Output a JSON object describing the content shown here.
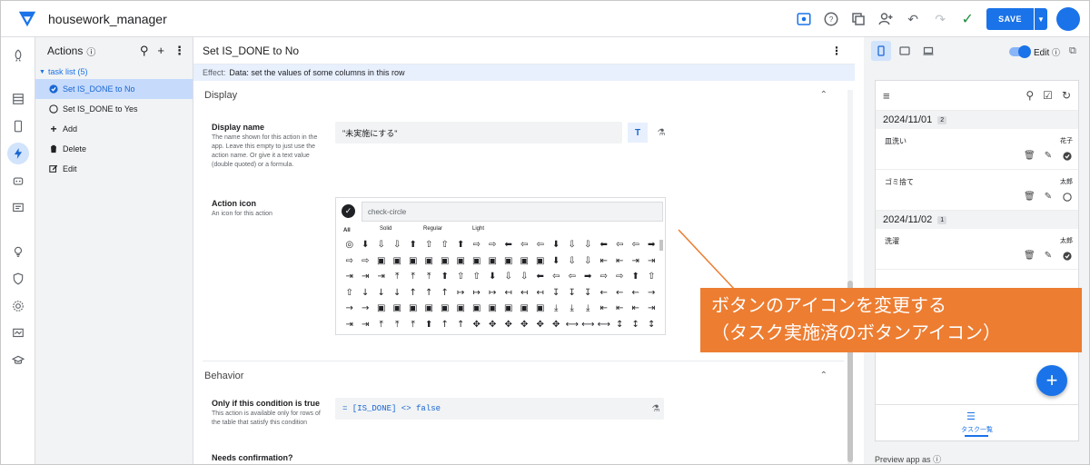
{
  "app": {
    "title": "housework_manager"
  },
  "topbar": {
    "save_label": "SAVE"
  },
  "actions_panel": {
    "title": "Actions",
    "group_label": "task list (5)",
    "items": [
      {
        "label": "Set IS_DONE to No"
      },
      {
        "label": "Set IS_DONE to Yes"
      },
      {
        "label": "Add"
      },
      {
        "label": "Delete"
      },
      {
        "label": "Edit"
      }
    ]
  },
  "editor": {
    "title": "Set IS_DONE to No",
    "effect_label": "Effect:",
    "effect_value": "Data: set the values of some columns in this row",
    "display_section": "Display",
    "display_name_label": "Display name",
    "display_name_desc": "The name shown for this action in the app. Leave this empty to just use the action name. Or give it a text value (double quoted) or a formula.",
    "display_name_value": "\"未実施にする\"",
    "action_icon_label": "Action icon",
    "action_icon_desc": "An icon for this action",
    "icon_search_placeholder": "check-circle",
    "picker_tabs": [
      "All",
      "Solid",
      "Regular",
      "Light"
    ],
    "behavior_section": "Behavior",
    "condition_label": "Only if this condition is true",
    "condition_desc": "This action is available only for rows of the table that satisfy this condition",
    "condition_value": "= [IS_DONE] <> false",
    "confirm_label": "Needs confirmation?"
  },
  "glyph_rows": [
    [
      "◎",
      "⬇",
      "⇩",
      "⇩",
      "⬆",
      "⇧",
      "⇧",
      "⬆",
      "⇨",
      "⇨",
      "⬅",
      "⇦",
      "⇦",
      "⬇",
      "⇩",
      "⇩",
      "⬅",
      "⇦",
      "⇦",
      "➡"
    ],
    [
      "⇨",
      "⇨",
      "▣",
      "▣",
      "▣",
      "▣",
      "▣",
      "▣",
      "▣",
      "▣",
      "▣",
      "▣",
      "▣",
      "⬇",
      "⇩",
      "⇩",
      "⇤",
      "⇤",
      "⇥",
      "⇥"
    ],
    [
      "⇥",
      "⇥",
      "⇥",
      "⤒",
      "⤒",
      "⤒",
      "⬆",
      "⇧",
      "⇧",
      "⬇",
      "⇩",
      "⇩",
      "⬅",
      "⇦",
      "⇦",
      "➡",
      "⇨",
      "⇨",
      "⬆",
      "⇧"
    ],
    [
      "⇧",
      "↓",
      "↓",
      "↓",
      "↑",
      "↑",
      "↑",
      "↦",
      "↦",
      "↦",
      "↤",
      "↤",
      "↤",
      "↧",
      "↧",
      "↧",
      "←",
      "←",
      "←",
      "→"
    ],
    [
      "→",
      "→",
      "▣",
      "▣",
      "▣",
      "▣",
      "▣",
      "▣",
      "▣",
      "▣",
      "▣",
      "▣",
      "▣",
      "⤓",
      "⤓",
      "⤓",
      "⇤",
      "⇤",
      "⇤",
      "⇥"
    ],
    [
      "⇥",
      "⇥",
      "⤒",
      "⤒",
      "⤒",
      "⬆",
      "↑",
      "↑",
      "✥",
      "✥",
      "✥",
      "✥",
      "✥",
      "✥",
      "⟷",
      "⟷",
      "⟷",
      "↕",
      "↕",
      "↕"
    ]
  ],
  "preview": {
    "edit_label": "Edit",
    "footer_label": "Preview app as",
    "groups": [
      {
        "date": "2024/11/01",
        "count": "2",
        "tasks": [
          {
            "name": "皿洗い",
            "person": "花子",
            "done": true
          },
          {
            "name": "ゴミ捨て",
            "person": "太郎",
            "done": false
          }
        ]
      },
      {
        "date": "2024/11/02",
        "count": "1",
        "tasks": [
          {
            "name": "洗濯",
            "person": "太郎",
            "done": true
          }
        ]
      }
    ],
    "nav_label": "タスク一覧"
  },
  "callout": {
    "line1": "ボタンのアイコンを変更する",
    "line2": "（タスク実施済のボタンアイコン）"
  },
  "colors": {
    "accent": "#1a73e8",
    "callout": "#ed7d31",
    "selected_bg": "#c6dafc"
  }
}
